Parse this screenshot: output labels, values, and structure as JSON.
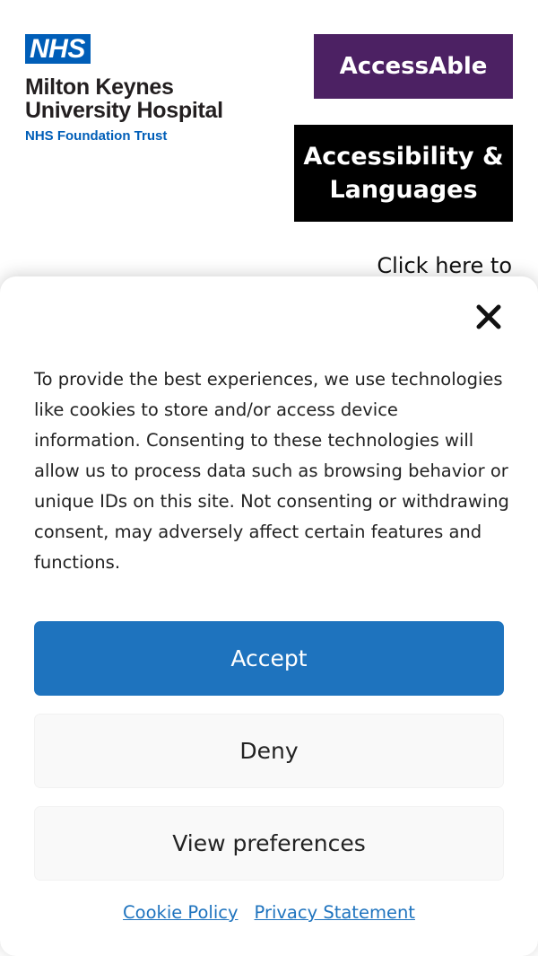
{
  "header": {
    "nhs_logo": "NHS",
    "org_name_line1": "Milton Keynes",
    "org_name_line2": "University Hospital",
    "org_trust": "NHS Foundation Trust",
    "accessable_label": "AccessAble",
    "accessibility_label": "Accessibility & Languages",
    "click_here_text": "Click here to",
    "colors": {
      "nhs_blue": "#005eb8",
      "accessable_purple": "#4c2163",
      "accessibility_black": "#000000"
    }
  },
  "cookie_banner": {
    "close_icon": "close-icon",
    "message": "To provide the best experiences, we use technologies like cookies to store and/or access device information. Consenting to these technologies will allow us to process data such as browsing behavior or unique IDs on this site. Not consenting or withdrawing consent, may adversely affect certain features and functions.",
    "accept_label": "Accept",
    "deny_label": "Deny",
    "preferences_label": "View preferences",
    "cookie_policy_label": "Cookie Policy",
    "privacy_statement_label": "Privacy Statement",
    "colors": {
      "accept_bg": "#1e73be",
      "secondary_bg": "#f9f9f9",
      "link": "#1e73be"
    }
  }
}
